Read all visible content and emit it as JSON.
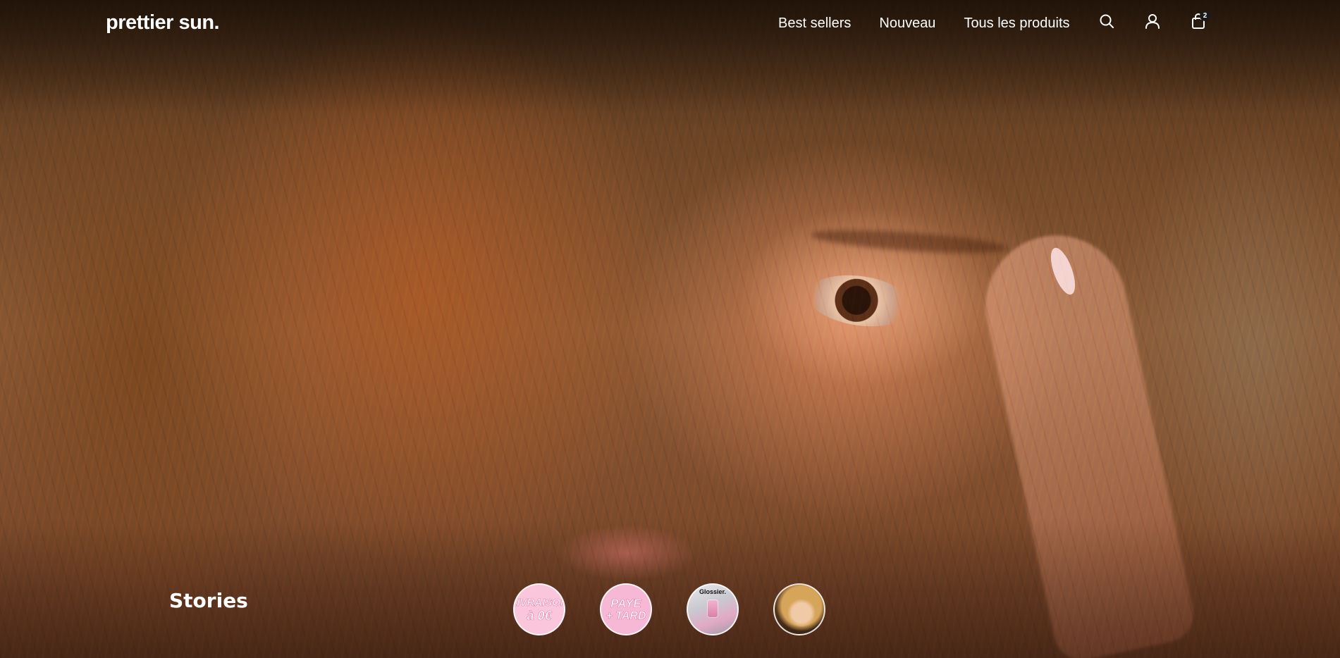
{
  "brand": {
    "logo_text": "prettier sun."
  },
  "nav": {
    "items": [
      {
        "label": "Best sellers"
      },
      {
        "label": "Nouveau"
      },
      {
        "label": "Tous les produits"
      }
    ]
  },
  "header_icons": {
    "search_icon": "search-icon",
    "account_icon": "user-icon",
    "cart_icon": "bag-icon",
    "cart_count": "2"
  },
  "stories": {
    "title": "Stories",
    "items": [
      {
        "line1": "LIVRAISON",
        "line2": "à 0€"
      },
      {
        "line1": "PAYE",
        "line2": "+ TARD"
      },
      {
        "brand_text": "Glossier."
      },
      {
        "icon": "portrait-thumbnail"
      }
    ]
  },
  "colors": {
    "text": "#ffffff",
    "badge_bg": "#1a1a1a",
    "story_pink": "#f9c6dc",
    "story_pink_accent": "#e67aa6"
  }
}
